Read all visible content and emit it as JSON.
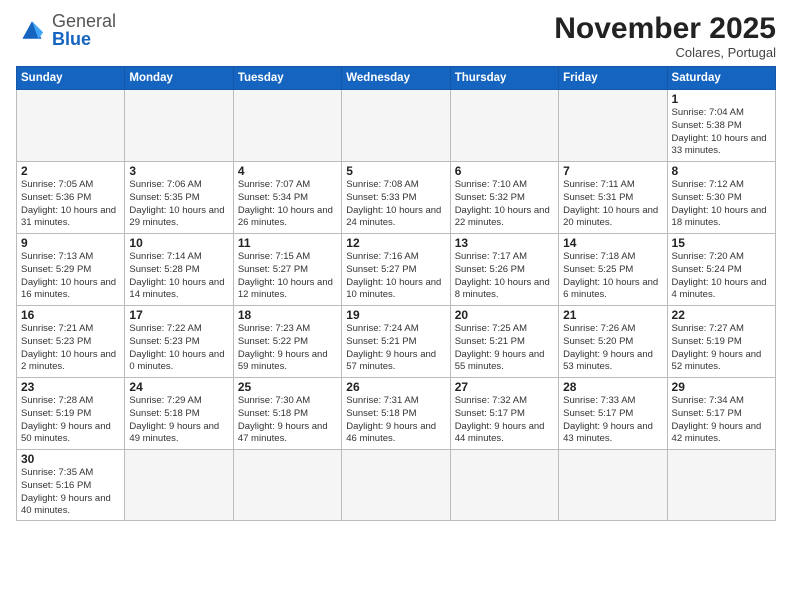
{
  "logo": {
    "general": "General",
    "blue": "Blue"
  },
  "header": {
    "month_title": "November 2025",
    "subtitle": "Colares, Portugal"
  },
  "weekdays": [
    "Sunday",
    "Monday",
    "Tuesday",
    "Wednesday",
    "Thursday",
    "Friday",
    "Saturday"
  ],
  "weeks": [
    [
      {
        "day": "",
        "info": ""
      },
      {
        "day": "",
        "info": ""
      },
      {
        "day": "",
        "info": ""
      },
      {
        "day": "",
        "info": ""
      },
      {
        "day": "",
        "info": ""
      },
      {
        "day": "",
        "info": ""
      },
      {
        "day": "1",
        "info": "Sunrise: 7:04 AM\nSunset: 5:38 PM\nDaylight: 10 hours and 33 minutes."
      }
    ],
    [
      {
        "day": "2",
        "info": "Sunrise: 7:05 AM\nSunset: 5:36 PM\nDaylight: 10 hours and 31 minutes."
      },
      {
        "day": "3",
        "info": "Sunrise: 7:06 AM\nSunset: 5:35 PM\nDaylight: 10 hours and 29 minutes."
      },
      {
        "day": "4",
        "info": "Sunrise: 7:07 AM\nSunset: 5:34 PM\nDaylight: 10 hours and 26 minutes."
      },
      {
        "day": "5",
        "info": "Sunrise: 7:08 AM\nSunset: 5:33 PM\nDaylight: 10 hours and 24 minutes."
      },
      {
        "day": "6",
        "info": "Sunrise: 7:10 AM\nSunset: 5:32 PM\nDaylight: 10 hours and 22 minutes."
      },
      {
        "day": "7",
        "info": "Sunrise: 7:11 AM\nSunset: 5:31 PM\nDaylight: 10 hours and 20 minutes."
      },
      {
        "day": "8",
        "info": "Sunrise: 7:12 AM\nSunset: 5:30 PM\nDaylight: 10 hours and 18 minutes."
      }
    ],
    [
      {
        "day": "9",
        "info": "Sunrise: 7:13 AM\nSunset: 5:29 PM\nDaylight: 10 hours and 16 minutes."
      },
      {
        "day": "10",
        "info": "Sunrise: 7:14 AM\nSunset: 5:28 PM\nDaylight: 10 hours and 14 minutes."
      },
      {
        "day": "11",
        "info": "Sunrise: 7:15 AM\nSunset: 5:27 PM\nDaylight: 10 hours and 12 minutes."
      },
      {
        "day": "12",
        "info": "Sunrise: 7:16 AM\nSunset: 5:27 PM\nDaylight: 10 hours and 10 minutes."
      },
      {
        "day": "13",
        "info": "Sunrise: 7:17 AM\nSunset: 5:26 PM\nDaylight: 10 hours and 8 minutes."
      },
      {
        "day": "14",
        "info": "Sunrise: 7:18 AM\nSunset: 5:25 PM\nDaylight: 10 hours and 6 minutes."
      },
      {
        "day": "15",
        "info": "Sunrise: 7:20 AM\nSunset: 5:24 PM\nDaylight: 10 hours and 4 minutes."
      }
    ],
    [
      {
        "day": "16",
        "info": "Sunrise: 7:21 AM\nSunset: 5:23 PM\nDaylight: 10 hours and 2 minutes."
      },
      {
        "day": "17",
        "info": "Sunrise: 7:22 AM\nSunset: 5:23 PM\nDaylight: 10 hours and 0 minutes."
      },
      {
        "day": "18",
        "info": "Sunrise: 7:23 AM\nSunset: 5:22 PM\nDaylight: 9 hours and 59 minutes."
      },
      {
        "day": "19",
        "info": "Sunrise: 7:24 AM\nSunset: 5:21 PM\nDaylight: 9 hours and 57 minutes."
      },
      {
        "day": "20",
        "info": "Sunrise: 7:25 AM\nSunset: 5:21 PM\nDaylight: 9 hours and 55 minutes."
      },
      {
        "day": "21",
        "info": "Sunrise: 7:26 AM\nSunset: 5:20 PM\nDaylight: 9 hours and 53 minutes."
      },
      {
        "day": "22",
        "info": "Sunrise: 7:27 AM\nSunset: 5:19 PM\nDaylight: 9 hours and 52 minutes."
      }
    ],
    [
      {
        "day": "23",
        "info": "Sunrise: 7:28 AM\nSunset: 5:19 PM\nDaylight: 9 hours and 50 minutes."
      },
      {
        "day": "24",
        "info": "Sunrise: 7:29 AM\nSunset: 5:18 PM\nDaylight: 9 hours and 49 minutes."
      },
      {
        "day": "25",
        "info": "Sunrise: 7:30 AM\nSunset: 5:18 PM\nDaylight: 9 hours and 47 minutes."
      },
      {
        "day": "26",
        "info": "Sunrise: 7:31 AM\nSunset: 5:18 PM\nDaylight: 9 hours and 46 minutes."
      },
      {
        "day": "27",
        "info": "Sunrise: 7:32 AM\nSunset: 5:17 PM\nDaylight: 9 hours and 44 minutes."
      },
      {
        "day": "28",
        "info": "Sunrise: 7:33 AM\nSunset: 5:17 PM\nDaylight: 9 hours and 43 minutes."
      },
      {
        "day": "29",
        "info": "Sunrise: 7:34 AM\nSunset: 5:17 PM\nDaylight: 9 hours and 42 minutes."
      }
    ],
    [
      {
        "day": "30",
        "info": "Sunrise: 7:35 AM\nSunset: 5:16 PM\nDaylight: 9 hours and 40 minutes."
      },
      {
        "day": "",
        "info": ""
      },
      {
        "day": "",
        "info": ""
      },
      {
        "day": "",
        "info": ""
      },
      {
        "day": "",
        "info": ""
      },
      {
        "day": "",
        "info": ""
      },
      {
        "day": "",
        "info": ""
      }
    ]
  ]
}
